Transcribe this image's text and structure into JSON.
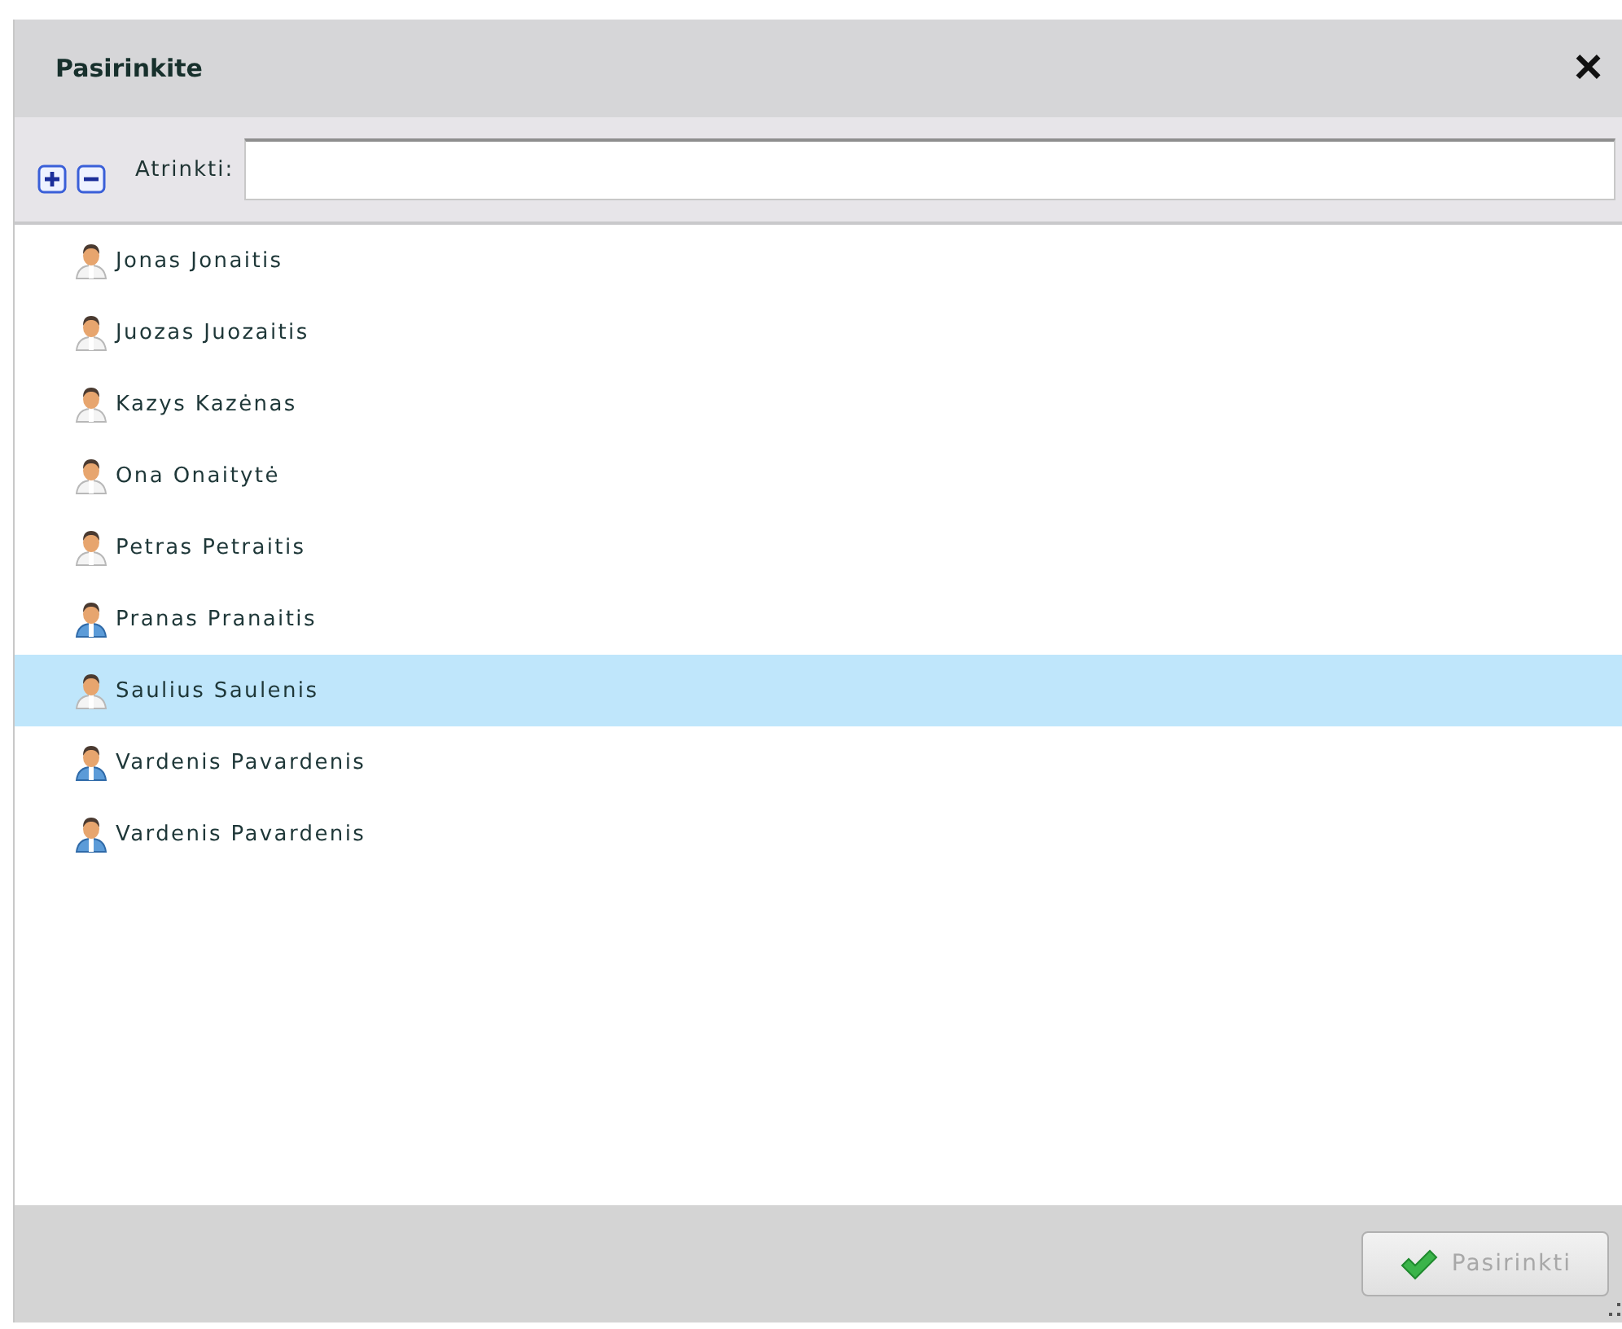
{
  "dialog": {
    "title": "Pasirinkite",
    "close": "×"
  },
  "toolbar": {
    "filter_label": "Atrinkti:"
  },
  "people": [
    {
      "name": "Jonas Jonaitis",
      "kind": "light",
      "selected": false
    },
    {
      "name": "Juozas Juozaitis",
      "kind": "light",
      "selected": false
    },
    {
      "name": "Kazys Kazėnas",
      "kind": "light",
      "selected": false
    },
    {
      "name": "Ona Onaitytė",
      "kind": "light",
      "selected": false
    },
    {
      "name": "Petras Petraitis",
      "kind": "light",
      "selected": false
    },
    {
      "name": "Pranas Pranaitis",
      "kind": "blue",
      "selected": false
    },
    {
      "name": "Saulius Saulenis",
      "kind": "light",
      "selected": true
    },
    {
      "name": "Vardenis Pavardenis",
      "kind": "blue",
      "selected": false
    },
    {
      "name": "Vardenis Pavardenis",
      "kind": "blue",
      "selected": false
    }
  ],
  "footer": {
    "button": {
      "label": "Pasirinkti",
      "disabled": true
    }
  }
}
